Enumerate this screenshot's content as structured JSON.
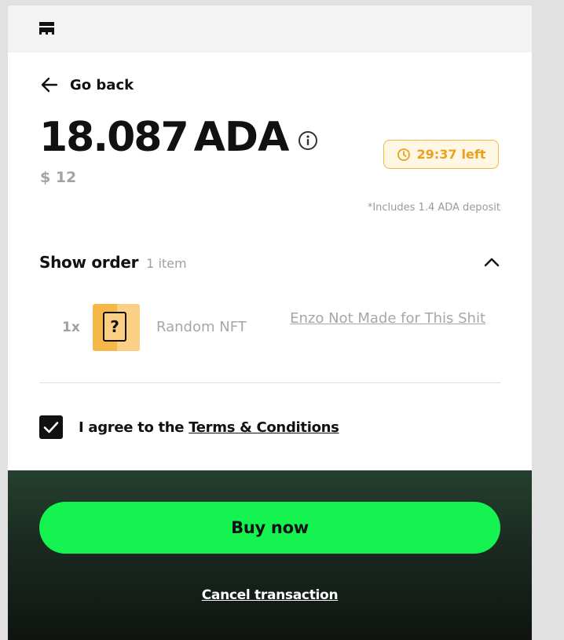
{
  "header": {
    "logo_icon": "brand-logo-icon"
  },
  "nav": {
    "back_label": "Go back"
  },
  "price": {
    "amount": "18.087",
    "currency": "ADA",
    "usd": "$ 12"
  },
  "timer": {
    "time": "29:37",
    "suffix": "left",
    "color": "#e8a21f"
  },
  "deposit_note": "*Includes 1.4 ADA deposit",
  "order": {
    "title": "Show order",
    "count": "1 item",
    "items": [
      {
        "qty": "1x",
        "name": "Random NFT",
        "collection": "Enzo Not Made for This Shit"
      }
    ]
  },
  "agreement": {
    "prefix": "I agree to the ",
    "link": "Terms & Conditions",
    "checked": true
  },
  "actions": {
    "buy_label": "Buy now",
    "cancel_label": "Cancel transaction",
    "buy_color": "#14f34f"
  }
}
